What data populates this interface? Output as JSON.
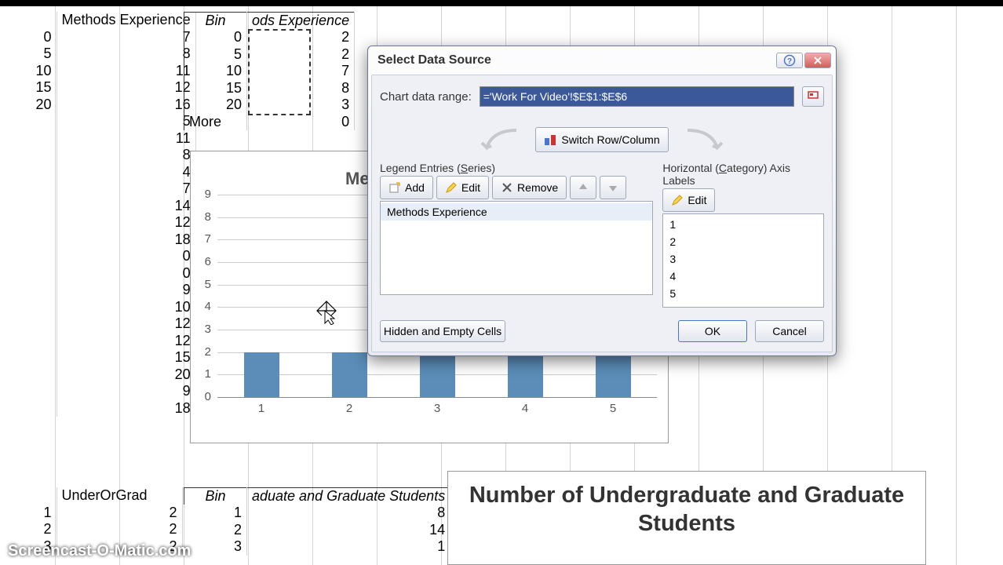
{
  "spreadsheet": {
    "table1": {
      "headers": [
        "",
        "Methods Experience"
      ],
      "rows": [
        [
          "0",
          "7"
        ],
        [
          "5",
          "8"
        ],
        [
          "10",
          "11"
        ],
        [
          "15",
          "12"
        ],
        [
          "20",
          "16"
        ],
        [
          "",
          "5"
        ],
        [
          "",
          "11"
        ],
        [
          "",
          "8"
        ],
        [
          "",
          "4"
        ],
        [
          "",
          "7"
        ],
        [
          "",
          "14"
        ],
        [
          "",
          "12"
        ],
        [
          "",
          "18"
        ],
        [
          "",
          "0"
        ],
        [
          "",
          "0"
        ],
        [
          "",
          "9"
        ],
        [
          "",
          "10"
        ],
        [
          "",
          "12"
        ],
        [
          "",
          "12"
        ],
        [
          "",
          "15"
        ],
        [
          "",
          "20"
        ],
        [
          "",
          "9"
        ],
        [
          "",
          "18"
        ]
      ]
    },
    "table2": {
      "headers": [
        "Bin",
        "ods Experience"
      ],
      "rows": [
        [
          "0",
          "2"
        ],
        [
          "5",
          "2"
        ],
        [
          "10",
          "7"
        ],
        [
          "15",
          "8"
        ],
        [
          "20",
          "3"
        ],
        [
          "More",
          "0"
        ]
      ]
    },
    "table3": {
      "headers": [
        "",
        "UnderOrGrad"
      ],
      "rows": [
        [
          "1",
          "2"
        ],
        [
          "2",
          "2"
        ],
        [
          "3",
          "2"
        ]
      ]
    },
    "table4": {
      "headers": [
        "Bin",
        "aduate and Graduate Students"
      ],
      "rows": [
        [
          "1",
          "8"
        ],
        [
          "2",
          "14"
        ],
        [
          "3",
          "1"
        ]
      ]
    }
  },
  "chart_data": [
    {
      "type": "bar",
      "title": "Methods Experience",
      "categories": [
        "1",
        "2",
        "3",
        "4",
        "5"
      ],
      "values": [
        2,
        2,
        2,
        2,
        2
      ],
      "y_ticks": [
        0,
        1,
        2,
        3,
        4,
        5,
        6,
        7,
        8,
        9
      ],
      "ylim": [
        0,
        9
      ]
    },
    {
      "type": "bar",
      "title": "Number of Undergraduate and Graduate Students",
      "categories": [],
      "values": []
    }
  ],
  "dialog": {
    "title": "Select Data Source",
    "chart_range_label": "Chart data range:",
    "chart_range_value": "='Work For Video'!$E$1:$E$6",
    "switch_label": "Switch Row/Column",
    "legend_panel_head": "Legend Entries (Series)",
    "axis_panel_head": "Horizontal (Category) Axis Labels",
    "add_label": "Add",
    "edit_label": "Edit",
    "remove_label": "Remove",
    "series": [
      "Methods Experience"
    ],
    "categories": [
      "1",
      "2",
      "3",
      "4",
      "5"
    ],
    "hidden_label": "Hidden and Empty Cells",
    "ok_label": "OK",
    "cancel_label": "Cancel"
  },
  "watermark": "Screencast-O-Matic.com"
}
